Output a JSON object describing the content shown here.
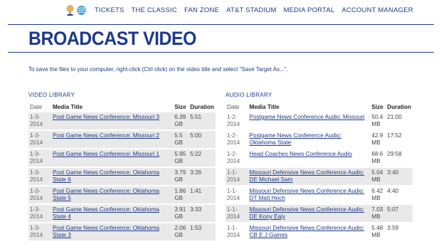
{
  "nav": {
    "items": [
      "TICKETS",
      "THE CLASSIC",
      "FAN ZONE",
      "AT&T STADIUM",
      "MEDIA PORTAL",
      "ACCOUNT MANAGER"
    ]
  },
  "page": {
    "title": "BROADCAST VIDEO",
    "instructions": "To save the files to your computer, right-click (Ctrl click) on the video title and select \"Save Target As...\"."
  },
  "video": {
    "section_title": "VIDEO LIBRARY",
    "headers": {
      "date": "Date",
      "title": "Media Title",
      "size": "Size",
      "duration": "Duration"
    },
    "rows": [
      {
        "date": "1-3-2014",
        "title": "Post Game News Conference: Missouri 3",
        "size": "6.39 GB",
        "duration": "5:51"
      },
      {
        "date": "1-3-2014",
        "title": "Post Game News Conference: Missouri 2",
        "size": "5.5 GB",
        "duration": "5:00"
      },
      {
        "date": "1-3-2014",
        "title": "Post Game News Conference: Missouri 1",
        "size": "5.95 GB",
        "duration": "5:22"
      },
      {
        "date": "1-3-2014",
        "title": "Post Game News Conference: Oklahoma State 6",
        "size": "3.79 GB",
        "duration": "3:26"
      },
      {
        "date": "1-3-2014",
        "title": "Post Game News Conference: Oklahoma State 5",
        "size": "1.86 GB",
        "duration": "1:41"
      },
      {
        "date": "1-3-2014",
        "title": "Post Game News Conference: Oklahoma State 4",
        "size": "3.91 GB",
        "duration": "3:33"
      },
      {
        "date": "1-3-2014",
        "title": "Post Game News Conference: Oklahoma State 3",
        "size": "2.06 GB",
        "duration": "1:53"
      }
    ]
  },
  "audio": {
    "section_title": "AUDIO LIBRARY",
    "headers": {
      "date": "Date",
      "title": "Media Title",
      "size": "Size",
      "duration": "Duration"
    },
    "rows": [
      {
        "date": "1-2-2014",
        "title": "Postgame News Conference Audio: Missouri",
        "size": "50.4 MB",
        "duration": "21:00"
      },
      {
        "date": "1-2-2014",
        "title": "Postgame News Conference Audio: Oklahoma State",
        "size": "42.9 MB",
        "duration": "17:52"
      },
      {
        "date": "1-2-2014",
        "title": "Head Coaches News Conference Audio",
        "size": "68.6 MB",
        "duration": "29:58"
      },
      {
        "date": "1-1-2014",
        "title": "Missouri Defensive News Conference Audio: DE Michael Sam",
        "size": "5.04 MB",
        "duration": "3:40"
      },
      {
        "date": "1-1-2014",
        "title": "Missouri Defensive News Conference Audio: DT Matt Hoch",
        "size": "6.42 MB",
        "duration": "4:40"
      },
      {
        "date": "1-1-2014",
        "title": "Missouri Defensive News Conference Audio: DE Kony Ealy",
        "size": "7.03 MB",
        "duration": "5:07"
      },
      {
        "date": "1-1-2014",
        "title": "Missouri Defensive News Conference Audio: CB E.J Gaines",
        "size": "5.48 MB",
        "duration": "3:59"
      }
    ]
  },
  "colors": {
    "brand_blue": "#1d3a8a",
    "row_shade": "#e9e9e9"
  }
}
